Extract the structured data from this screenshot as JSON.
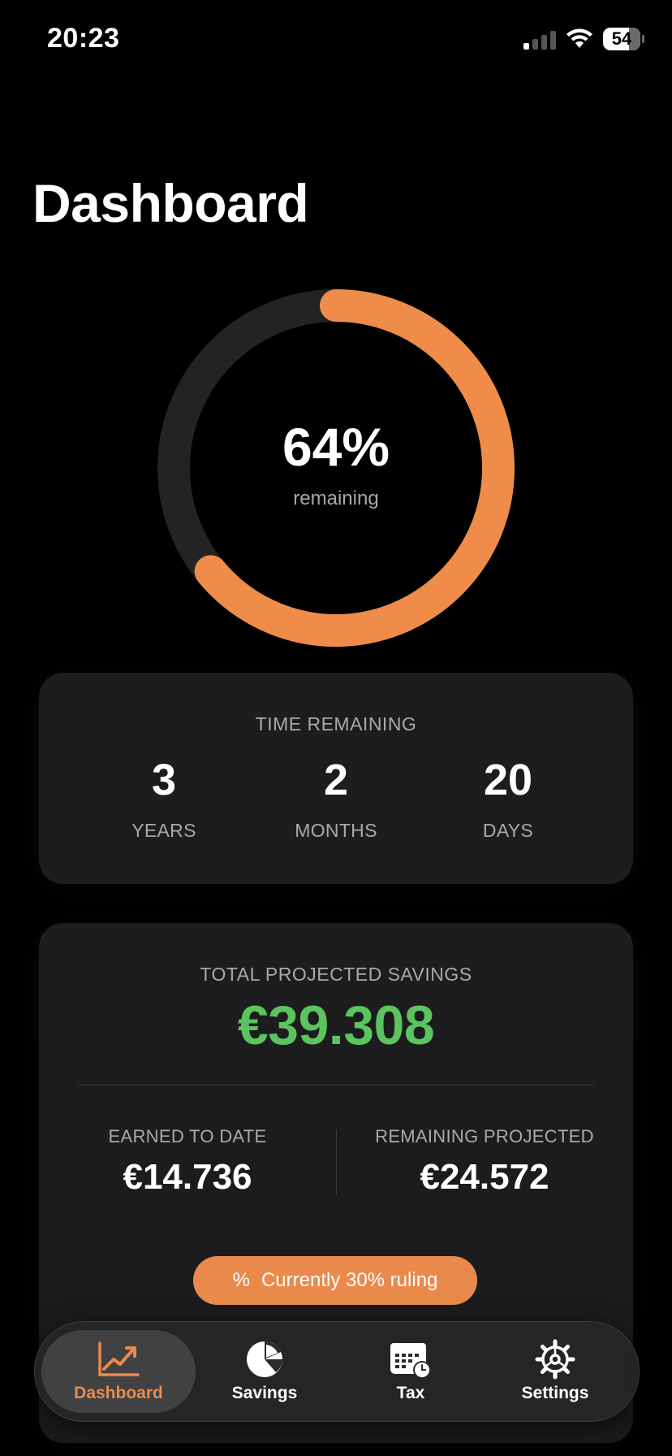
{
  "status_bar": {
    "time": "20:23",
    "battery": "54"
  },
  "page": {
    "title": "Dashboard"
  },
  "progress": {
    "percent_remaining": 64,
    "percent_label": "64%",
    "sub_label": "remaining",
    "arc_color": "#EF8C4A",
    "track_color": "#232323"
  },
  "time_remaining": {
    "title": "TIME REMAINING",
    "items": [
      {
        "value": "3",
        "unit": "YEARS"
      },
      {
        "value": "2",
        "unit": "MONTHS"
      },
      {
        "value": "20",
        "unit": "DAYS"
      }
    ]
  },
  "savings": {
    "title": "TOTAL PROJECTED SAVINGS",
    "total": "€39.308",
    "total_color": "#5BC45E",
    "earned_label": "EARNED TO DATE",
    "earned_value": "€14.736",
    "remaining_label": "REMAINING PROJECTED",
    "remaining_value": "€24.572",
    "ruling_icon": "%",
    "ruling_label": "Currently 30% ruling"
  },
  "tabs": [
    {
      "label": "Dashboard",
      "icon": "chart-line-icon",
      "active": true
    },
    {
      "label": "Savings",
      "icon": "pie-chart-icon",
      "active": false
    },
    {
      "label": "Tax",
      "icon": "calendar-clock-icon",
      "active": false
    },
    {
      "label": "Settings",
      "icon": "gear-icon",
      "active": false
    }
  ],
  "accent_color": "#E98A4C"
}
